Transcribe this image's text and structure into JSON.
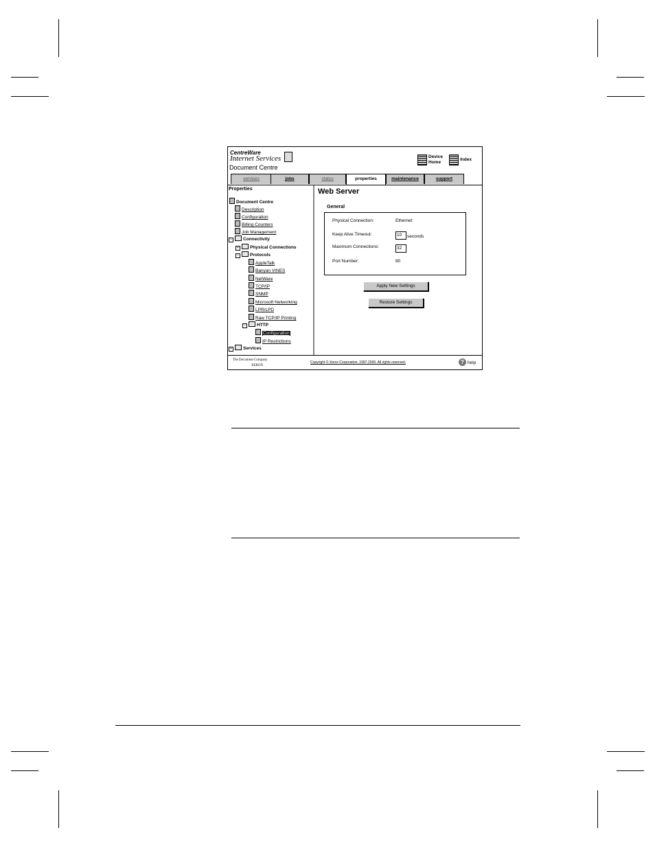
{
  "screenshot": {
    "brand_line1": "CentreWare",
    "brand_line2": "Internet Services",
    "app_title": "Document Centre",
    "header_links": {
      "device_home_1": "Device",
      "device_home_2": "Home",
      "index": "Index"
    },
    "tabs": [
      {
        "label": "services",
        "active": false
      },
      {
        "label": "jobs",
        "active": false
      },
      {
        "label": "status",
        "active": false
      },
      {
        "label": "properties",
        "active": true
      },
      {
        "label": "maintenance",
        "active": false
      },
      {
        "label": "support",
        "active": false
      }
    ],
    "sidebar": {
      "title": "Properties",
      "items": [
        {
          "label": "Document Centre"
        },
        {
          "label": "Description"
        },
        {
          "label": "Configuration"
        },
        {
          "label": "Billing Counters"
        },
        {
          "label": "Job Management"
        },
        {
          "label": "Connectivity",
          "toggle": "−"
        },
        {
          "label": "Physical Connections",
          "toggle": "+"
        },
        {
          "label": "Protocols",
          "toggle": "−"
        },
        {
          "label": "AppleTalk"
        },
        {
          "label": "Banyan VINES"
        },
        {
          "label": "NetWare"
        },
        {
          "label": "TCP/IP"
        },
        {
          "label": "SNMP"
        },
        {
          "label": "Microsoft Networking"
        },
        {
          "label": "LPR/LPD"
        },
        {
          "label": "Raw TCP/IP Printing"
        },
        {
          "label": "HTTP",
          "toggle": "−"
        },
        {
          "label": "Configuration",
          "selected": true
        },
        {
          "label": "IP Restrictions"
        },
        {
          "label": "Services",
          "toggle": "+"
        }
      ]
    },
    "main": {
      "title": "Web Server",
      "section": "General",
      "fields": {
        "physical_connection_label": "Physical Connection:",
        "physical_connection_value": "Ethernet",
        "keep_alive_label": "Keep Alive Timeout:",
        "keep_alive_value": "10",
        "keep_alive_unit": "seconds",
        "max_conn_label": "Maximum Connections:",
        "max_conn_value": "32",
        "port_label": "Port Number:",
        "port_value": "80"
      },
      "apply_button": "Apply New Settings",
      "restore_button": "Restore Settings"
    },
    "footer": {
      "company": "The Document Company",
      "brand": "XEROX",
      "copyright": "Copyright © Xerox Corporation, 1997-2000. All rights reserved.",
      "help": "help"
    }
  }
}
